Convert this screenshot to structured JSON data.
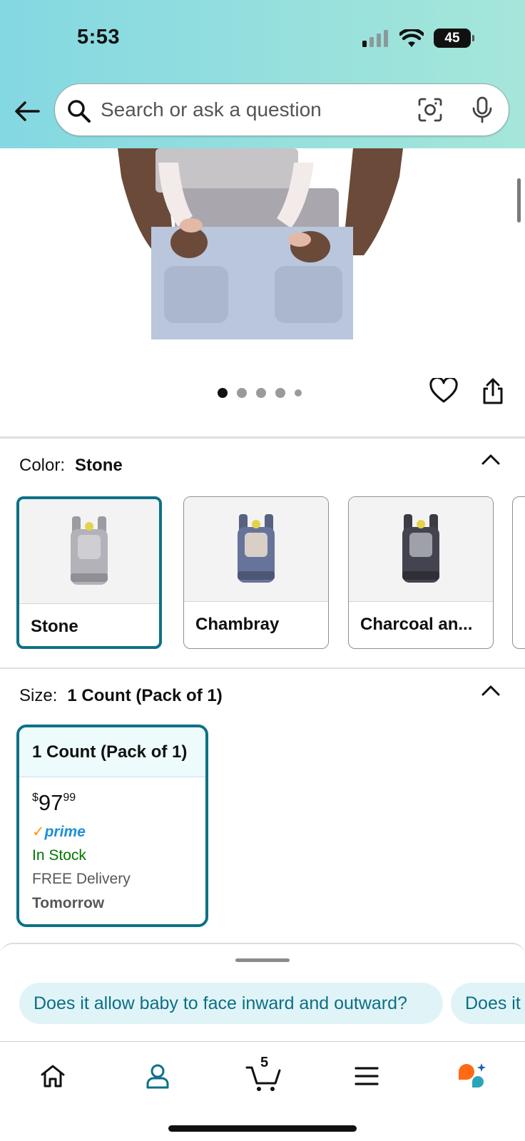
{
  "status_bar": {
    "time": "5:53",
    "battery": "45"
  },
  "search": {
    "placeholder": "Search or ask a question"
  },
  "gallery": {
    "total_images": 5,
    "active_index": 0
  },
  "color": {
    "label": "Color:",
    "selected": "Stone",
    "options": [
      {
        "name": "Stone",
        "selected": true
      },
      {
        "name": "Chambray",
        "selected": false
      },
      {
        "name": "Charcoal an...",
        "selected": false
      }
    ]
  },
  "size": {
    "label": "Size:",
    "selected": "1 Count (Pack of 1)",
    "card": {
      "title": "1 Count (Pack of 1)",
      "price_currency": "$",
      "price_whole": "97",
      "price_cents": "99",
      "prime": "prime",
      "stock": "In Stock",
      "delivery": "FREE Delivery",
      "delivery_date": "Tomorrow"
    }
  },
  "questions": [
    "Does it allow baby to face inward and outward?",
    "Does it"
  ],
  "tabbar": {
    "cart_count": "5"
  },
  "colors": {
    "accent": "#0d7186",
    "chip_bg": "#e0f4f7",
    "in_stock": "#007600",
    "prime_blue": "#1c8fd6",
    "rufus_orange": "#ff6a13"
  }
}
